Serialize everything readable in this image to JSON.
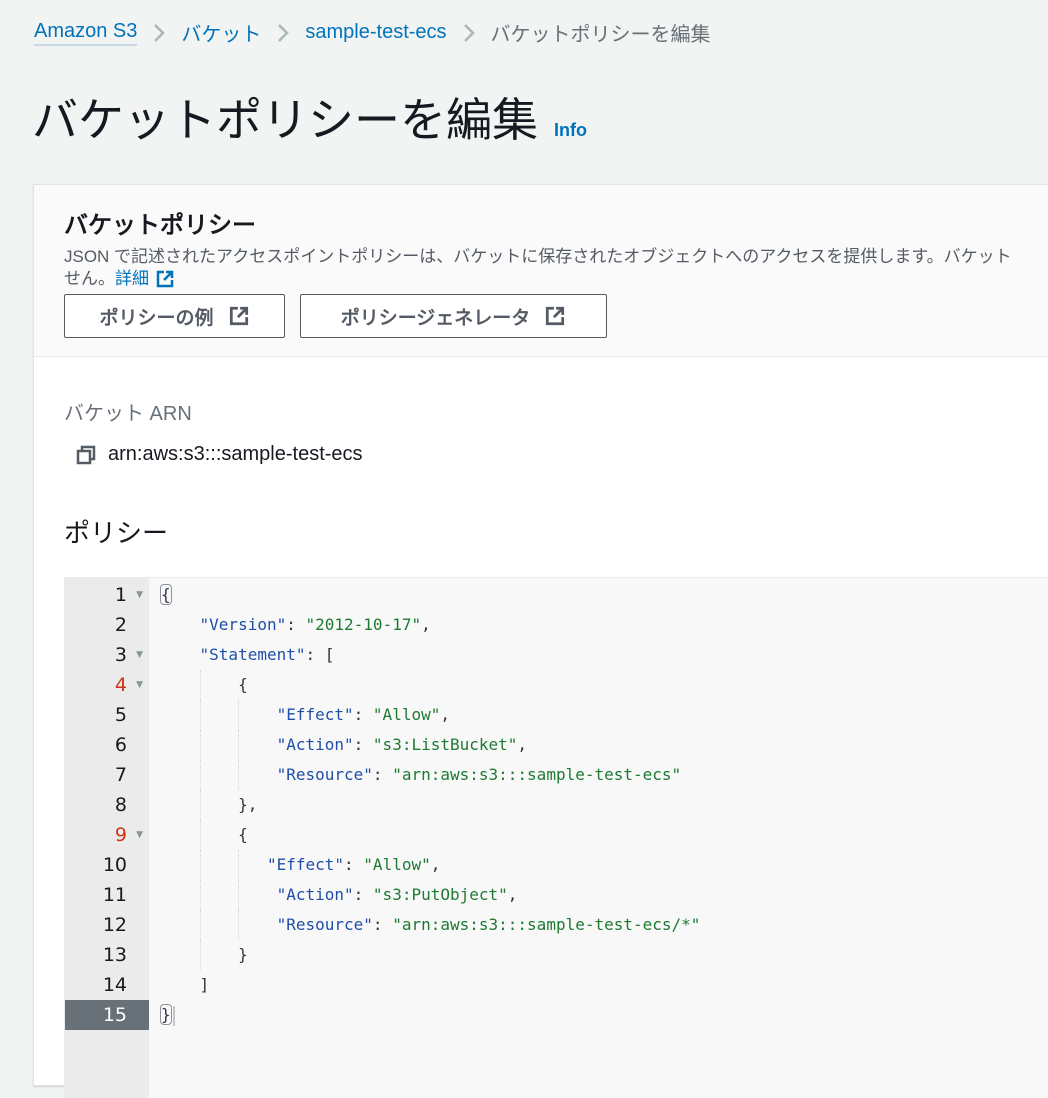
{
  "breadcrumb": {
    "items": [
      "Amazon S3",
      "バケット",
      "sample-test-ecs"
    ],
    "current": "バケットポリシーを編集"
  },
  "page": {
    "title": "バケットポリシーを編集",
    "info_link": "Info"
  },
  "panel": {
    "title": "バケットポリシー",
    "description_line1": "JSON で記述されたアクセスポイントポリシーは、バケットに保存されたオブジェクトへのアクセスを提供します。バケット",
    "description_line2": "せん。",
    "details_link": "詳細",
    "buttons": {
      "policy_examples": "ポリシーの例",
      "policy_generator": "ポリシージェネレータ"
    }
  },
  "arn": {
    "label": "バケット ARN",
    "value": "arn:aws:s3:::sample-test-ecs"
  },
  "policy": {
    "label": "ポリシー",
    "lines": [
      {
        "n": "1",
        "fold": true,
        "err": false
      },
      {
        "n": "2",
        "fold": false,
        "err": false
      },
      {
        "n": "3",
        "fold": true,
        "err": false
      },
      {
        "n": "4",
        "fold": true,
        "err": true
      },
      {
        "n": "5",
        "fold": false,
        "err": false
      },
      {
        "n": "6",
        "fold": false,
        "err": false
      },
      {
        "n": "7",
        "fold": false,
        "err": false
      },
      {
        "n": "8",
        "fold": false,
        "err": false
      },
      {
        "n": "9",
        "fold": true,
        "err": true
      },
      {
        "n": "10",
        "fold": false,
        "err": false
      },
      {
        "n": "11",
        "fold": false,
        "err": false
      },
      {
        "n": "12",
        "fold": false,
        "err": false
      },
      {
        "n": "13",
        "fold": false,
        "err": false
      },
      {
        "n": "14",
        "fold": false,
        "err": false
      },
      {
        "n": "15",
        "fold": false,
        "err": false,
        "active": true
      }
    ],
    "code": {
      "l2_key": "\"Version\"",
      "l2_val": "\"2012-10-17\"",
      "l3_key": "\"Statement\"",
      "l5_key": "\"Effect\"",
      "l5_val": "\"Allow\"",
      "l6_key": "\"Action\"",
      "l6_val": "\"s3:ListBucket\"",
      "l7_key": "\"Resource\"",
      "l7_val": "\"arn:aws:s3:::sample-test-ecs\"",
      "l10_key": "\"Effect\"",
      "l10_val": "\"Allow\"",
      "l11_key": "\"Action\"",
      "l11_val": "\"s3:PutObject\"",
      "l12_key": "\"Resource\"",
      "l12_val": "\"arn:aws:s3:::sample-test-ecs/*\""
    }
  },
  "colors": {
    "link": "#0073bb",
    "json_key": "#1f4fa8",
    "json_string": "#1e7a32",
    "error_line_number": "#d13212",
    "active_line_bg": "#687078"
  }
}
